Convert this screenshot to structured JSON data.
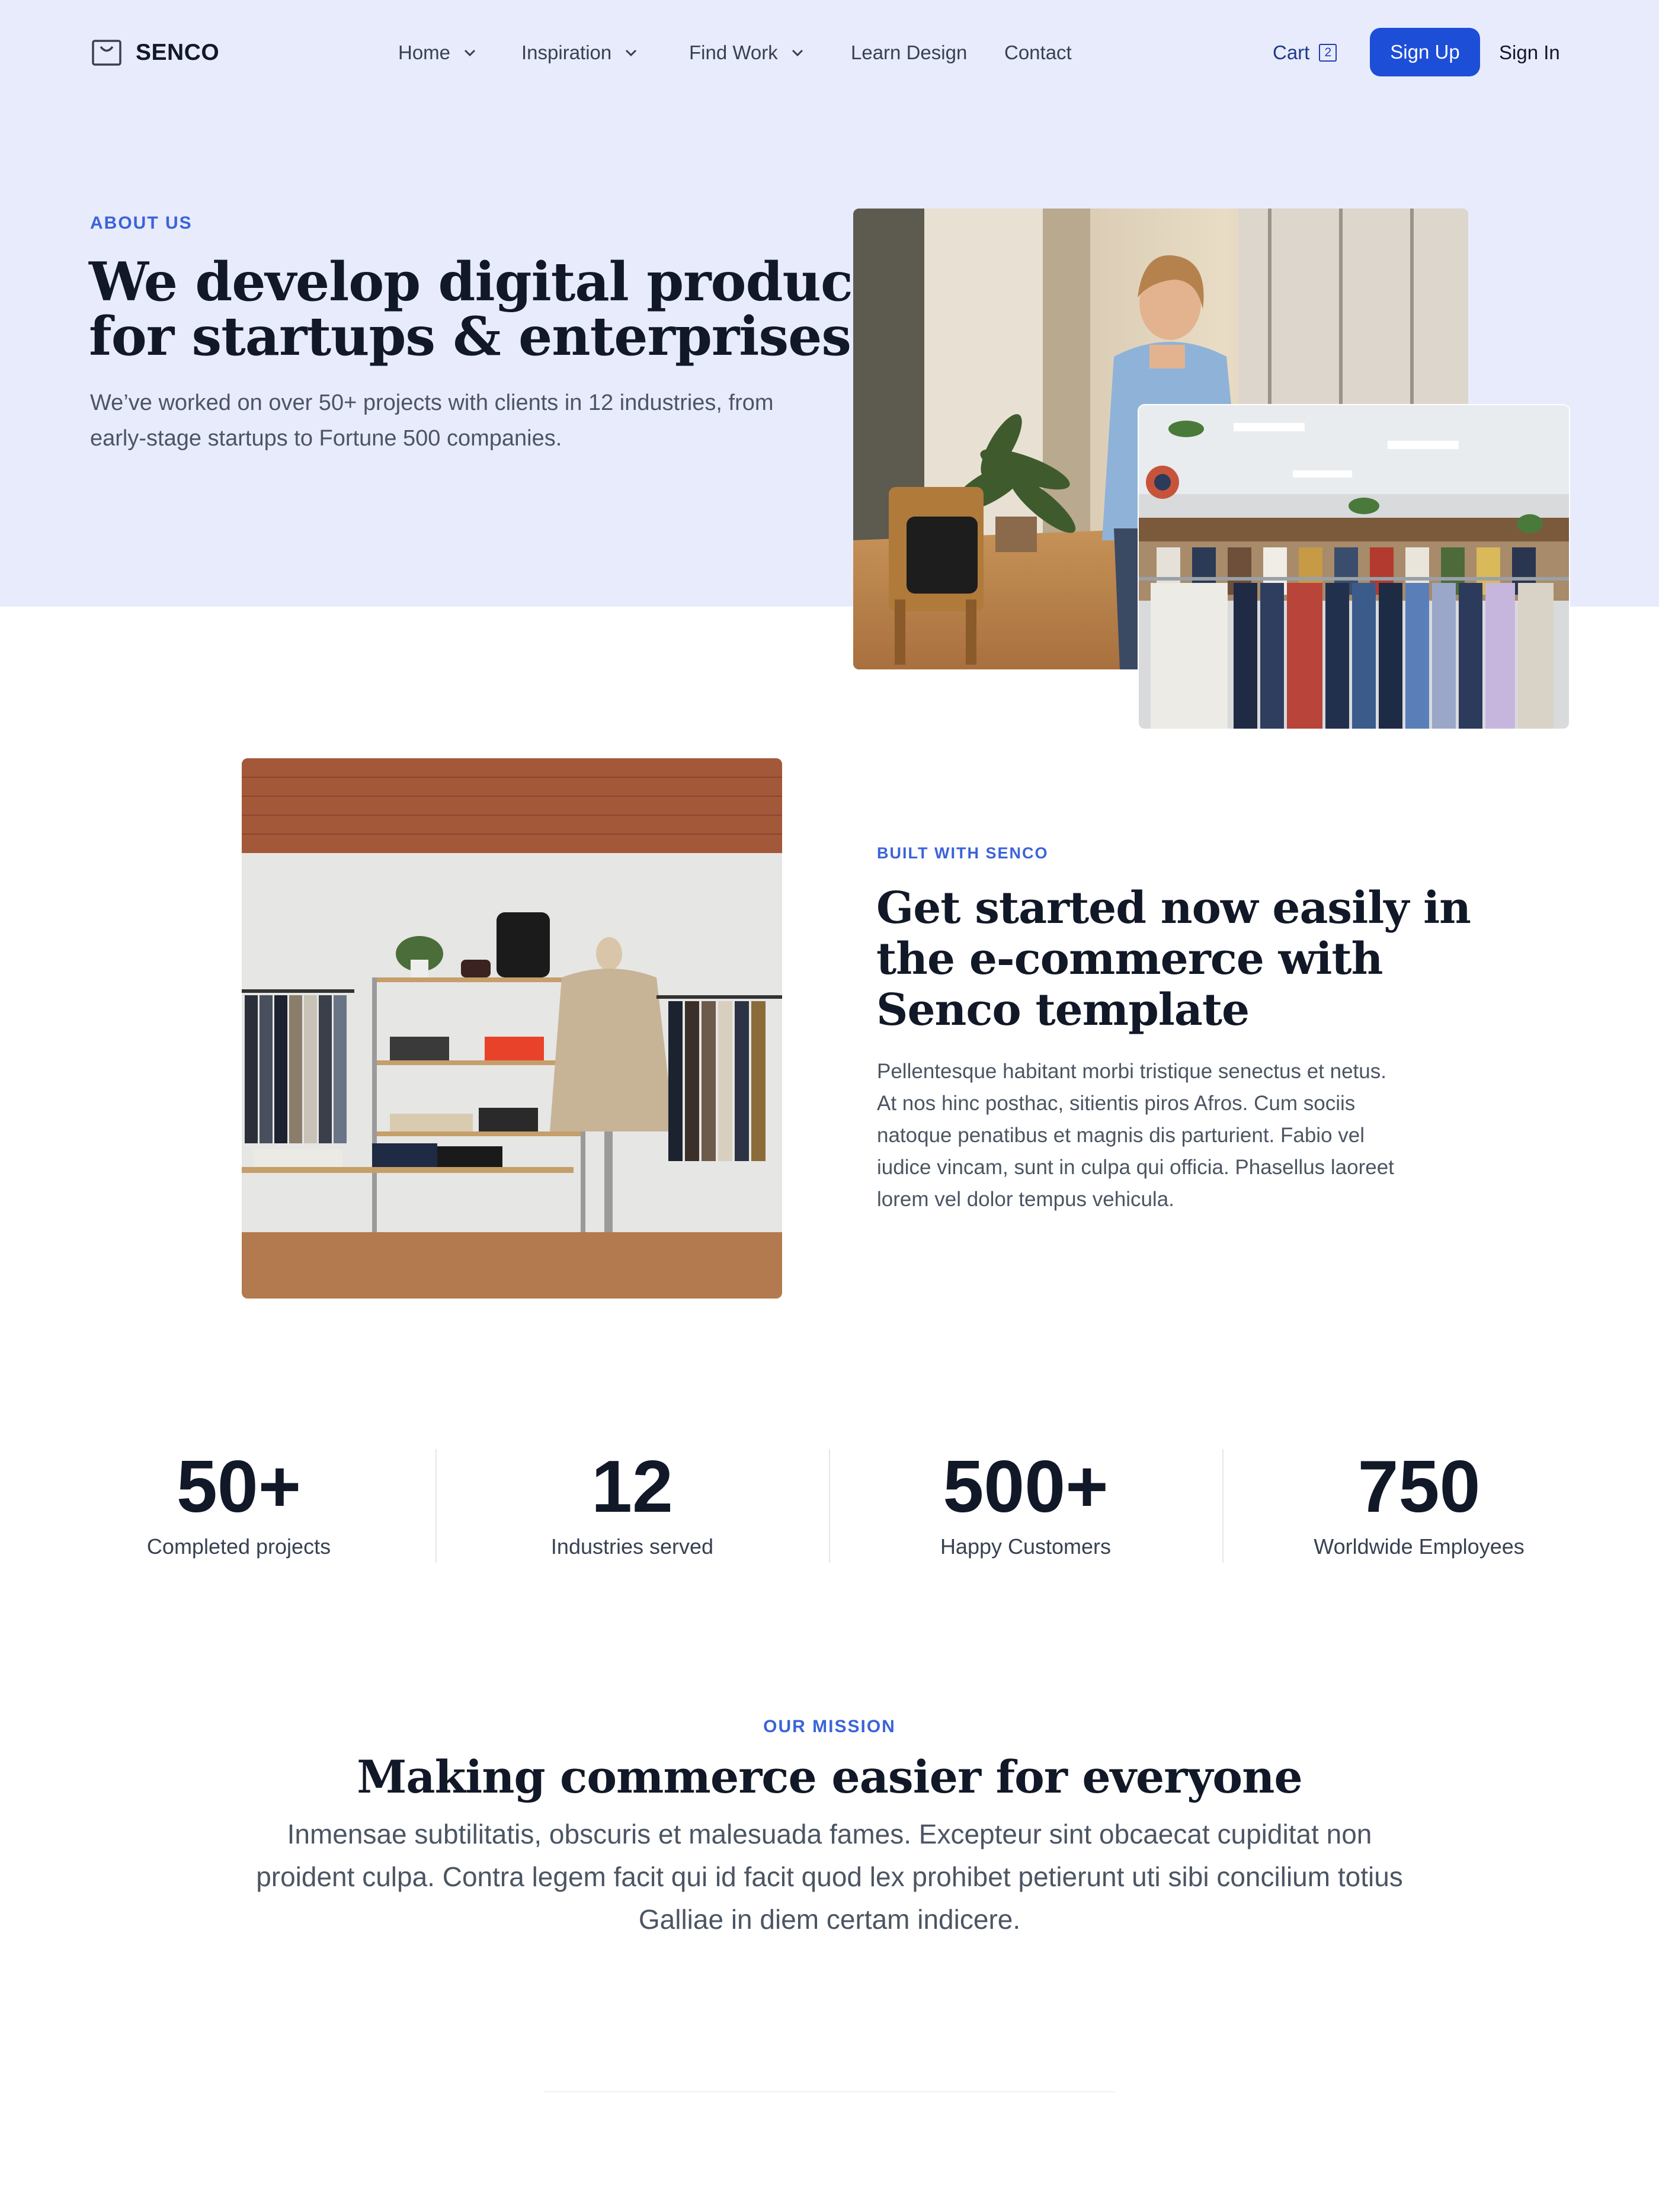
{
  "brand": {
    "name": "SENCO"
  },
  "nav": {
    "items": [
      {
        "label": "Home",
        "dropdown": true
      },
      {
        "label": "Inspiration",
        "dropdown": true
      },
      {
        "label": "Find Work",
        "dropdown": true
      },
      {
        "label": "Learn Design",
        "dropdown": false
      },
      {
        "label": "Contact",
        "dropdown": false
      }
    ],
    "cart_label": "Cart",
    "cart_count": "2",
    "signup_label": "Sign Up",
    "signin_label": "Sign In"
  },
  "hero": {
    "eyebrow": "ABOUT US",
    "title_line1": "We develop digital products",
    "title_line2": "for startups & enterprises",
    "desc_line1": "We’ve worked on over 50+ projects with clients in 12 industries, from",
    "desc_line2": "early-stage startups to Fortune 500 companies."
  },
  "feature": {
    "eyebrow": "BUILT WITH SENCO",
    "title_line1": "Get started now easily in",
    "title_line2": "the e-commerce with",
    "title_line3": "Senco template",
    "desc_lines": [
      "Pellentesque habitant morbi tristique senectus et netus.",
      "At nos hinc posthac, sitientis piros Afros. Cum sociis",
      "natoque penatibus et magnis dis parturient. Fabio vel",
      "iudice vincam, sunt in culpa qui officia. Phasellus laoreet",
      "lorem vel dolor tempus vehicula."
    ]
  },
  "stats": [
    {
      "value": "50+",
      "label": "Completed projects"
    },
    {
      "value": "12",
      "label": "Industries served"
    },
    {
      "value": "500+",
      "label": "Happy Customers"
    },
    {
      "value": "750",
      "label": "Worldwide Employees"
    }
  ],
  "mission": {
    "eyebrow": "OUR MISSION",
    "title": "Making commerce easier for everyone",
    "text_lines": [
      "Inmensae subtilitatis, obscuris et malesuada fames. Excepteur sint obcaecat cupiditat non",
      "proident culpa. Contra legem facit qui id facit quod lex prohibet petierunt uti sibi concilium totius",
      "Galliae in diem certam indicere."
    ]
  },
  "colors": {
    "hero_bg": "#e8ebfc",
    "accent": "#1d4ed8",
    "eyebrow": "#3b63d8"
  },
  "icons": {
    "logo": "shopping-bag-icon",
    "dropdown": "chevron-down-icon"
  }
}
